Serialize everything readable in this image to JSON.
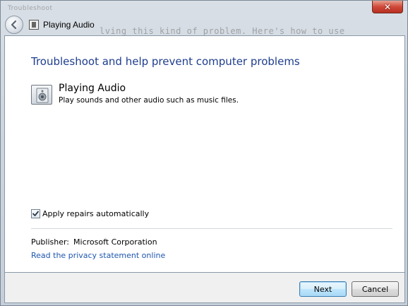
{
  "window": {
    "title": "Playing Audio",
    "close_glyph": "✕",
    "background_text": "lving this kind of problem. Here's how to use",
    "background_small_text": "Troubleshoot"
  },
  "main": {
    "heading": "Troubleshoot and help prevent computer problems",
    "troubleshooter": {
      "title": "Playing Audio",
      "description": "Play sounds and other audio such as music files.",
      "icon": "audio-speaker-icon"
    },
    "apply_repairs": {
      "label": "Apply repairs automatically",
      "checked": true
    },
    "publisher": {
      "label": "Publisher:",
      "value": "Microsoft Corporation"
    },
    "privacy_link": "Read the privacy statement online"
  },
  "buttons": {
    "next": "Next",
    "cancel": "Cancel"
  },
  "colors": {
    "heading": "#1e3d8e",
    "link": "#1e56b0",
    "close_button": "#d0493a"
  }
}
